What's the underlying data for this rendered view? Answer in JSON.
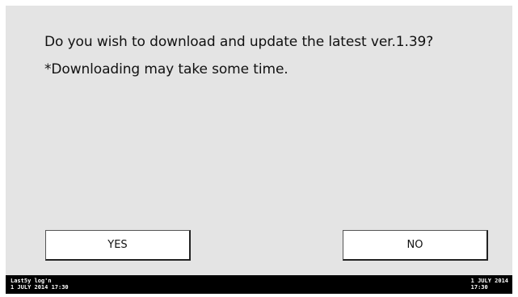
{
  "dialog": {
    "message_line1": "Do you wish to download and update the latest ver.1.39?",
    "message_line2": "*Downloading may take some time."
  },
  "buttons": {
    "yes_label": "YES",
    "no_label": "NO"
  },
  "statusbar": {
    "left_line1": "Last5y log'n",
    "left_line2": "1 JULY 2014 17:30",
    "right_line1": "1 JULY 2014",
    "right_line2": "17:30"
  }
}
